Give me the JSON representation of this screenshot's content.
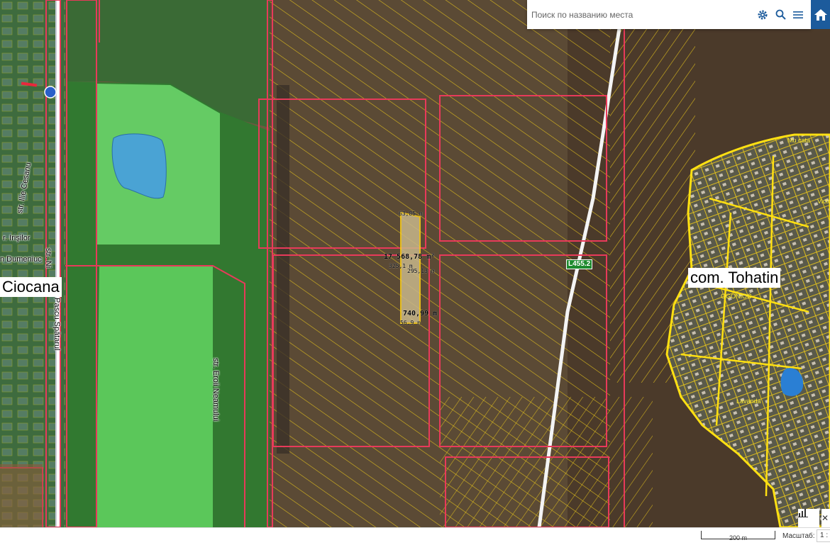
{
  "search": {
    "placeholder": "Поиск по названию места"
  },
  "icons": {
    "settings": "gear-icon",
    "search": "search-icon",
    "menu": "menu-icon",
    "home": "home-icon",
    "chart": "chart-icon"
  },
  "colors": {
    "accent": "#1c5b9c",
    "parcel_outline": "#e8c61a",
    "cadastral_boundary": "#e83a5a",
    "green_zone": "#5fd35f",
    "water": "#4aa3d4",
    "road_badge": "#1e8a2e"
  },
  "places": {
    "ciocana": "Ciocana",
    "tohatin": "com. Tohatin"
  },
  "streets": {
    "cesanu": "str. Ilie Cesanu",
    "irisilor": "r. Irişilor",
    "dumeniuc": "n Dumeniuc",
    "vasile": "str. Ni",
    "pascu": "Pascu Spătarul",
    "eroii": "str. Eroii Neamului"
  },
  "localities": {
    "ogonioc": "OGONIOC",
    "lavanda": "Lavanda",
    "mucata": "Mu cata",
    "victoria": "Victo"
  },
  "road": {
    "label": "L455.2"
  },
  "parcel": {
    "area": "17 568,78 m²",
    "top_width": "63,85 m",
    "left_side": "325,1 m",
    "right_side": "295,13 m",
    "perimeter": "740,99 m",
    "bottom_width": "56,9 m"
  },
  "footer": {
    "scale_distance": "200 m",
    "scale_label": "Масштаб:",
    "scale_value": "1 :"
  },
  "controls": {
    "close": "✕"
  }
}
